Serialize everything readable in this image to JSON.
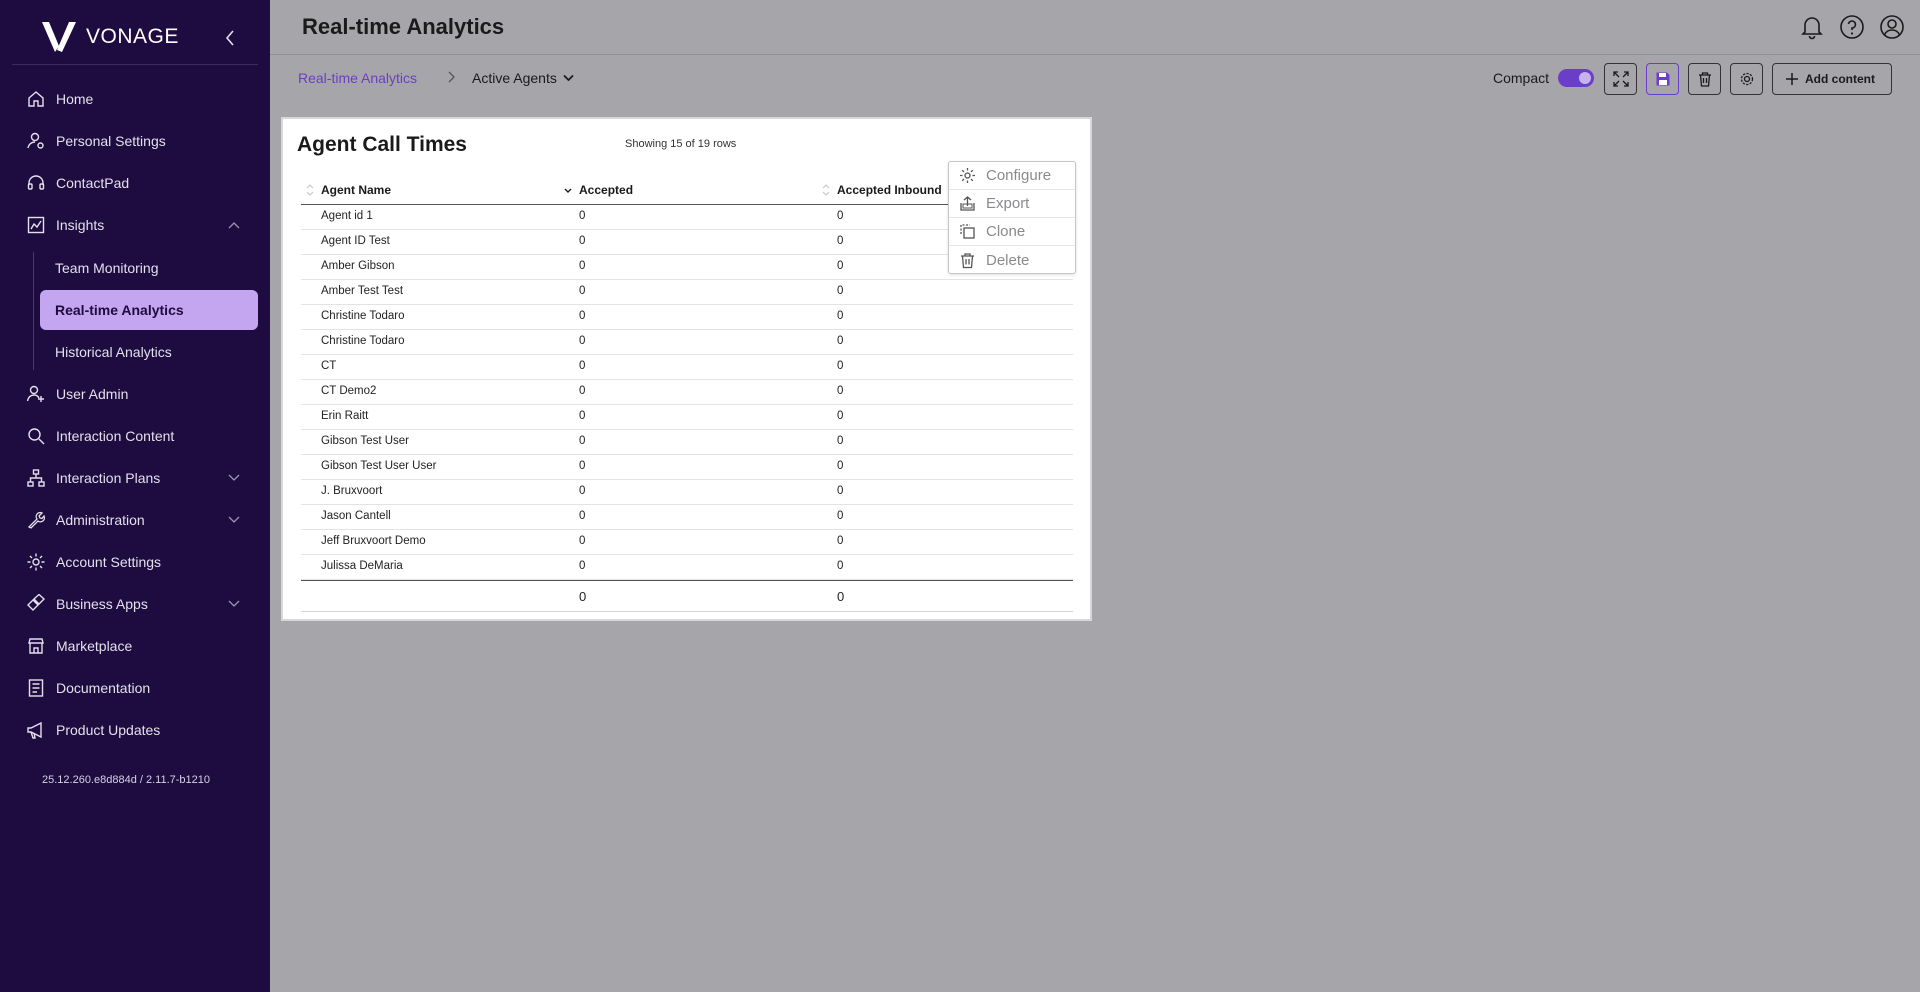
{
  "sidebar": {
    "brand": "VONAGE",
    "items": [
      {
        "label": "Home",
        "icon": "home-icon"
      },
      {
        "label": "Personal Settings",
        "icon": "user-settings-icon"
      },
      {
        "label": "ContactPad",
        "icon": "headset-icon"
      },
      {
        "label": "Insights",
        "icon": "chart-icon",
        "expanded": true
      },
      {
        "label": "User Admin",
        "icon": "user-add-icon"
      },
      {
        "label": "Interaction Content",
        "icon": "search-icon"
      },
      {
        "label": "Interaction Plans",
        "icon": "hierarchy-icon"
      },
      {
        "label": "Administration",
        "icon": "wrench-icon"
      },
      {
        "label": "Account Settings",
        "icon": "gear-icon"
      },
      {
        "label": "Business Apps",
        "icon": "apps-icon"
      },
      {
        "label": "Marketplace",
        "icon": "store-icon"
      },
      {
        "label": "Documentation",
        "icon": "document-icon"
      },
      {
        "label": "Product Updates",
        "icon": "megaphone-icon"
      }
    ],
    "insights_sub": [
      {
        "label": "Team Monitoring"
      },
      {
        "label": "Real-time Analytics",
        "active": true
      },
      {
        "label": "Historical Analytics"
      }
    ],
    "version": "25.12.260.e8d884d / 2.11.7-b1210"
  },
  "header": {
    "title": "Real-time Analytics"
  },
  "toolbar": {
    "breadcrumb_link": "Real-time Analytics",
    "breadcrumb_current": "Active Agents",
    "compact_label": "Compact",
    "compact_on": true,
    "add_content_label": "Add content"
  },
  "widget": {
    "title": "Agent Call Times",
    "rows_info": "Showing 15 of 19 rows",
    "columns": [
      "Agent Name",
      "Accepted",
      "Accepted Inbound"
    ],
    "rows": [
      [
        "Agent id 1",
        "0",
        "0"
      ],
      [
        "Agent ID Test",
        "0",
        "0"
      ],
      [
        "Amber Gibson",
        "0",
        "0"
      ],
      [
        "Amber Test Test",
        "0",
        "0"
      ],
      [
        "Christine Todaro",
        "0",
        "0"
      ],
      [
        "Christine Todaro",
        "0",
        "0"
      ],
      [
        "CT",
        "0",
        "0"
      ],
      [
        "CT Demo2",
        "0",
        "0"
      ],
      [
        "Erin Raitt",
        "0",
        "0"
      ],
      [
        "Gibson Test User",
        "0",
        "0"
      ],
      [
        "Gibson Test User User",
        "0",
        "0"
      ],
      [
        "J. Bruxvoort",
        "0",
        "0"
      ],
      [
        "Jason Cantell",
        "0",
        "0"
      ],
      [
        "Jeff Bruxvoort Demo",
        "0",
        "0"
      ],
      [
        "Julissa DeMaria",
        "0",
        "0"
      ]
    ],
    "totals": [
      "",
      "0",
      "0"
    ]
  },
  "context_menu": {
    "items": [
      {
        "label": "Configure",
        "icon": "gear-icon"
      },
      {
        "label": "Export",
        "icon": "export-icon"
      },
      {
        "label": "Clone",
        "icon": "clone-icon"
      },
      {
        "label": "Delete",
        "icon": "trash-icon"
      }
    ]
  },
  "colors": {
    "sidebar_bg": "#1e0b3f",
    "accent": "#6b3ec9",
    "active_nav_bg": "#c3a5f0",
    "content_bg": "#a6a5aa"
  }
}
